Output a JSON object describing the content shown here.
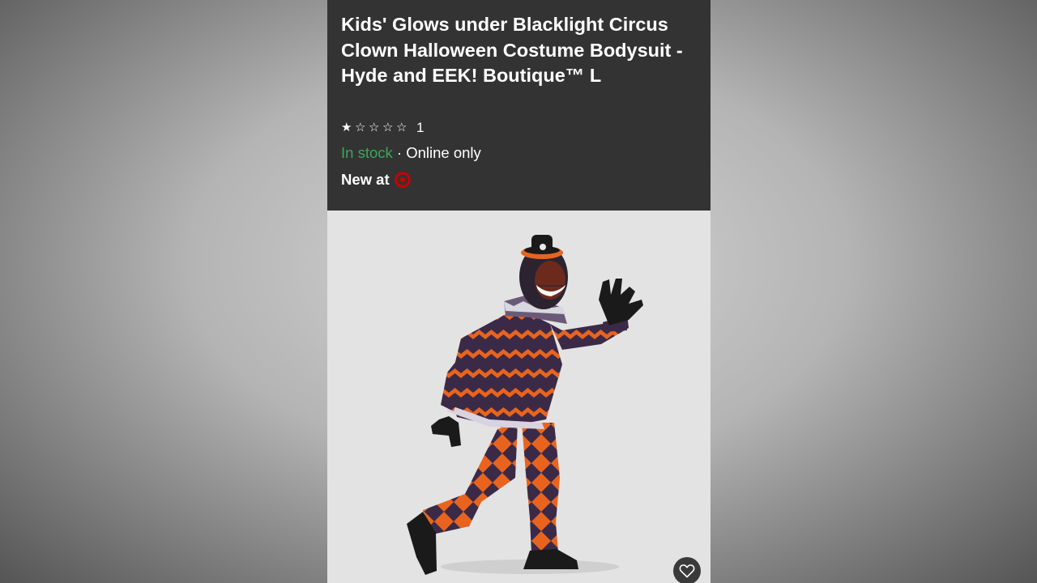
{
  "product": {
    "title": "Kids' Glows under Blacklight Circus Clown Halloween Costume Bodysuit - Hyde and EEK! Boutique™ L",
    "rating": 1,
    "rating_max": 5,
    "review_count": "1",
    "stock_status": "In stock",
    "availability_separator": " · ",
    "availability_note": "Online only",
    "new_at_label": "New at"
  },
  "icons": {
    "rating_star_filled": "★",
    "rating_star_empty": "☆",
    "store_logo": "target-bullseye-icon",
    "favorite": "heart-outline-icon"
  },
  "colors": {
    "info_background": "#333333",
    "in_stock": "#3aa85a",
    "target_red": "#cc0000",
    "image_background": "#e3e3e3",
    "costume_orange": "#e8641e",
    "costume_purple": "#3b2a47"
  }
}
